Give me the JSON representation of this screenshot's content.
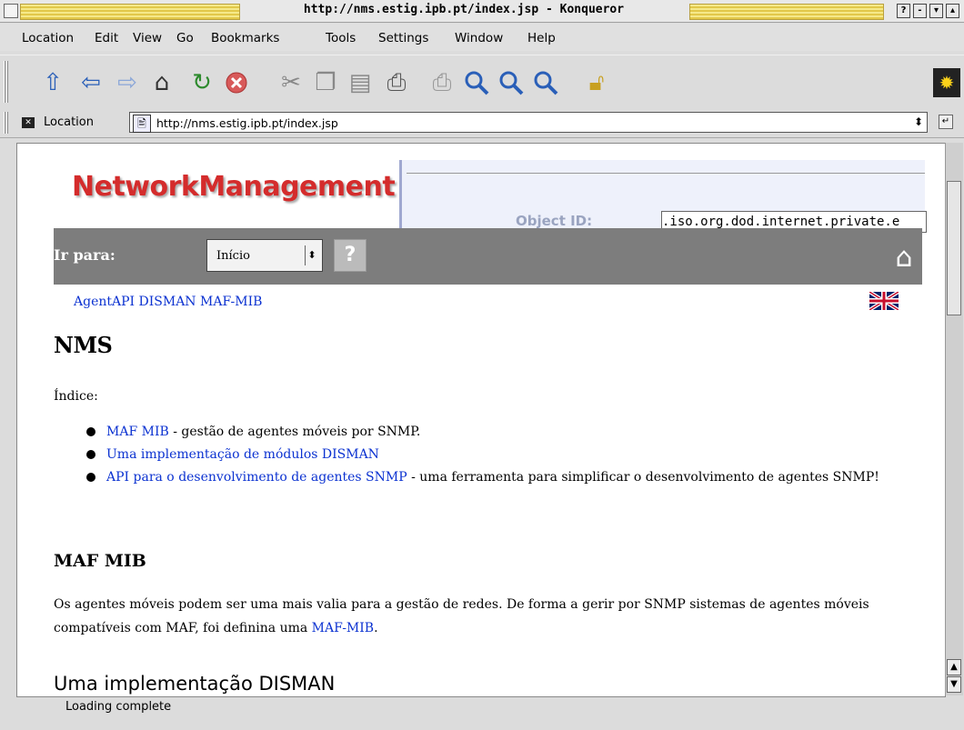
{
  "window": {
    "title": "http://nms.estig.ipb.pt/index.jsp - Konqueror",
    "buttons": [
      "?",
      "-",
      "▾",
      "▴"
    ]
  },
  "menubar": {
    "items": [
      "Location",
      "Edit",
      "View",
      "Go",
      "Bookmarks",
      "Tools",
      "Settings",
      "Window",
      "Help"
    ]
  },
  "toolbar": {
    "icons": [
      "up-arrow-icon",
      "back-arrow-icon",
      "forward-arrow-icon",
      "home-icon",
      "reload-icon",
      "stop-icon",
      "cut-icon",
      "copy-icon",
      "paste-icon",
      "print-icon",
      "print-frame-icon",
      "zoom-in-icon",
      "zoom-icon",
      "zoom-out-icon",
      "security-lock-icon"
    ]
  },
  "locationbar": {
    "label": "Location",
    "url": "http://nms.estig.ipb.pt/index.jsp"
  },
  "status": {
    "text": "Loading complete"
  },
  "page": {
    "logo": "NetworkManagement",
    "app_object_label": "Object ID:",
    "app_object_value": ".iso.org.dod.internet.private.e",
    "nav_label": "Ir para:",
    "nav_select_value": "Início",
    "nav_help": "?",
    "topic_links": [
      "AgentAPI",
      "DISMAN",
      "MAF-MIB"
    ],
    "heading": "NMS",
    "index_label": "Índice:",
    "toc": [
      {
        "link": "MAF MIB",
        "text": " - gestão de agentes móveis por SNMP."
      },
      {
        "link": "Uma implementação de módulos DISMAN",
        "text": ""
      },
      {
        "link": "API para o desenvolvimento de agentes SNMP",
        "text": " - uma ferramenta para simplificar o desenvolvimento de agentes SNMP!"
      }
    ],
    "section1_heading": "MAF MIB",
    "section1_para": "Os agentes móveis podem ser uma mais valia para a gestão de redes. De forma a gerir por SNMP sistemas de agentes móveis compatíveis com MAF, foi definina uma ",
    "section1_link": "MAF-MIB",
    "section1_end": ".",
    "section2_heading": "Uma implementação DISMAN"
  }
}
